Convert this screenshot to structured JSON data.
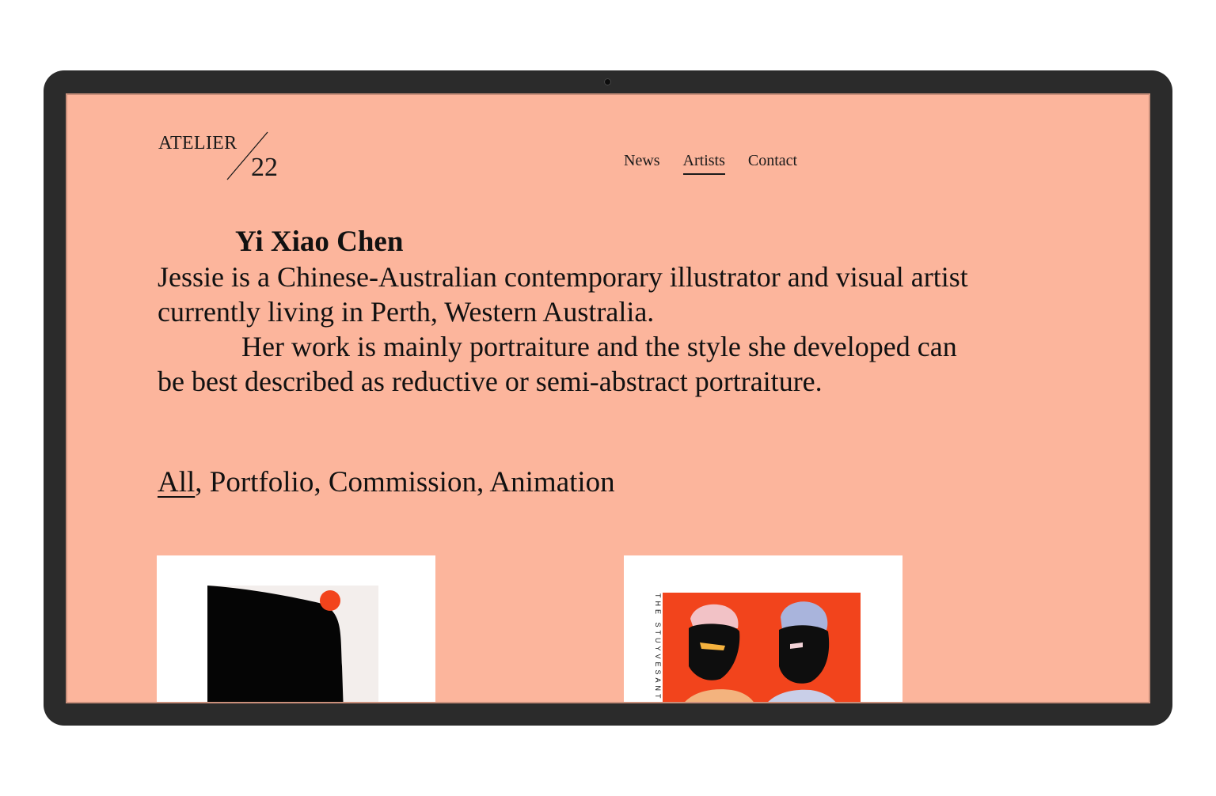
{
  "logo": {
    "word": "ATELIER",
    "number": "22"
  },
  "nav": {
    "items": [
      {
        "label": "News"
      },
      {
        "label": "Artists"
      },
      {
        "label": "Contact"
      }
    ]
  },
  "artist": {
    "name": "Yi Xiao Chen",
    "bio_1": "Jessie is a Chinese-Australian contemporary illustrator and visual artist currently living in Perth, Western Australia.",
    "bio_2": "Her work is mainly portraiture and the style she developed can be best described as reductive or semi-abstract portraiture."
  },
  "filters": {
    "items": [
      "All",
      "Portfolio",
      "Commission",
      "Animation"
    ],
    "separator": ", "
  },
  "artworks": {
    "second_vertical_text": "THE STUYVESANT"
  },
  "colors": {
    "page_background": "#fcb59c",
    "bezel": "#2b2b2b",
    "accent_red": "#f2441c",
    "text": "#111111"
  }
}
